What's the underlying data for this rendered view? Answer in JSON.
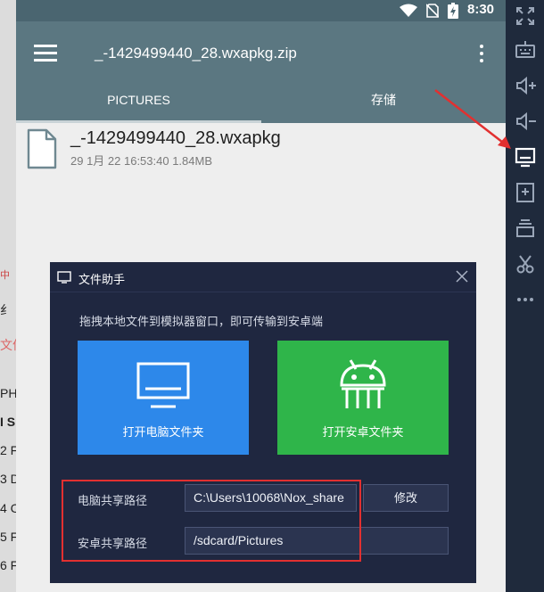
{
  "background_fragments": [
    "中",
    "纟",
    "文件",
    "PH",
    "I S",
    "2 F",
    "3 D",
    "4 C",
    "5 F",
    "6 F"
  ],
  "status_bar": {
    "time": "8:30",
    "icons": [
      "wifi-icon",
      "no-sim-icon",
      "battery-charging-icon"
    ]
  },
  "toolbar": {
    "title": "_-1429499440_28.wxapkg.zip"
  },
  "tabs": [
    {
      "label": "PICTURES",
      "active": true
    },
    {
      "label": "存储",
      "active": false
    }
  ],
  "file": {
    "name": "_-1429499440_28.wxapkg",
    "meta": "29 1月 22 16:53:40  1.84MB"
  },
  "sidebar_icons": [
    "fullscreen-icon",
    "keyboard-icon",
    "volume-up-icon",
    "volume-down-icon",
    "file-assistant-icon",
    "install-apk-icon",
    "multi-instance-icon",
    "screenshot-scissors-icon",
    "more-icon"
  ],
  "dialog": {
    "title": "文件助手",
    "hint": "拖拽本地文件到模拟器窗口，即可传输到安卓端",
    "pc_button_label": "打开电脑文件夹",
    "android_button_label": "打开安卓文件夹",
    "pc_path_label": "电脑共享路径",
    "pc_path_value": "C:\\Users\\10068\\Nox_share",
    "modify_label": "修改",
    "android_path_label": "安卓共享路径",
    "android_path_value": "/sdcard/Pictures"
  },
  "colors": {
    "status_bar": "#4a6570",
    "toolbar": "#5b7781",
    "sidebar": "#1f2a3c",
    "dialog": "#1f2740",
    "pc_button": "#2d88ea",
    "android_button": "#2fb54a",
    "annotation": "#e23030"
  }
}
